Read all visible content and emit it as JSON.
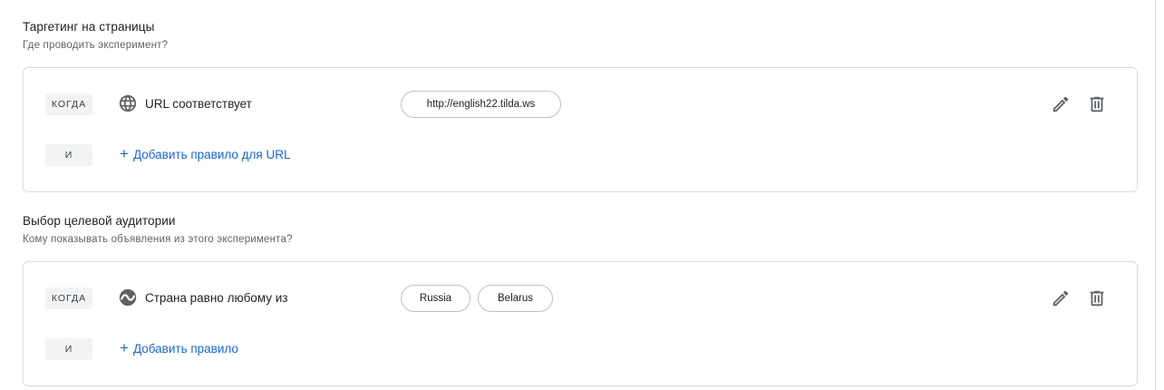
{
  "targeting": {
    "title": "Таргетинг на страницы",
    "subtitle": "Где проводить эксперимент?",
    "when_label": "КОГДА",
    "and_label": "И",
    "rule_icon": "globe-icon",
    "rule_text": "URL соответствует",
    "values": [
      "http://english22.tilda.ws"
    ],
    "add_label": "Добавить правило для URL"
  },
  "audience": {
    "title": "Выбор целевой аудитории",
    "subtitle": "Кому показывать объявления из этого эксперимента?",
    "when_label": "КОГДА",
    "and_label": "И",
    "rule_icon": "location-globe-icon",
    "rule_text": "Страна равно любому из",
    "values": [
      "Russia",
      "Belarus"
    ],
    "add_label": "Добавить правило"
  },
  "colors": {
    "link": "#1967d2",
    "border": "#dadce0",
    "icon": "#5f6368"
  }
}
